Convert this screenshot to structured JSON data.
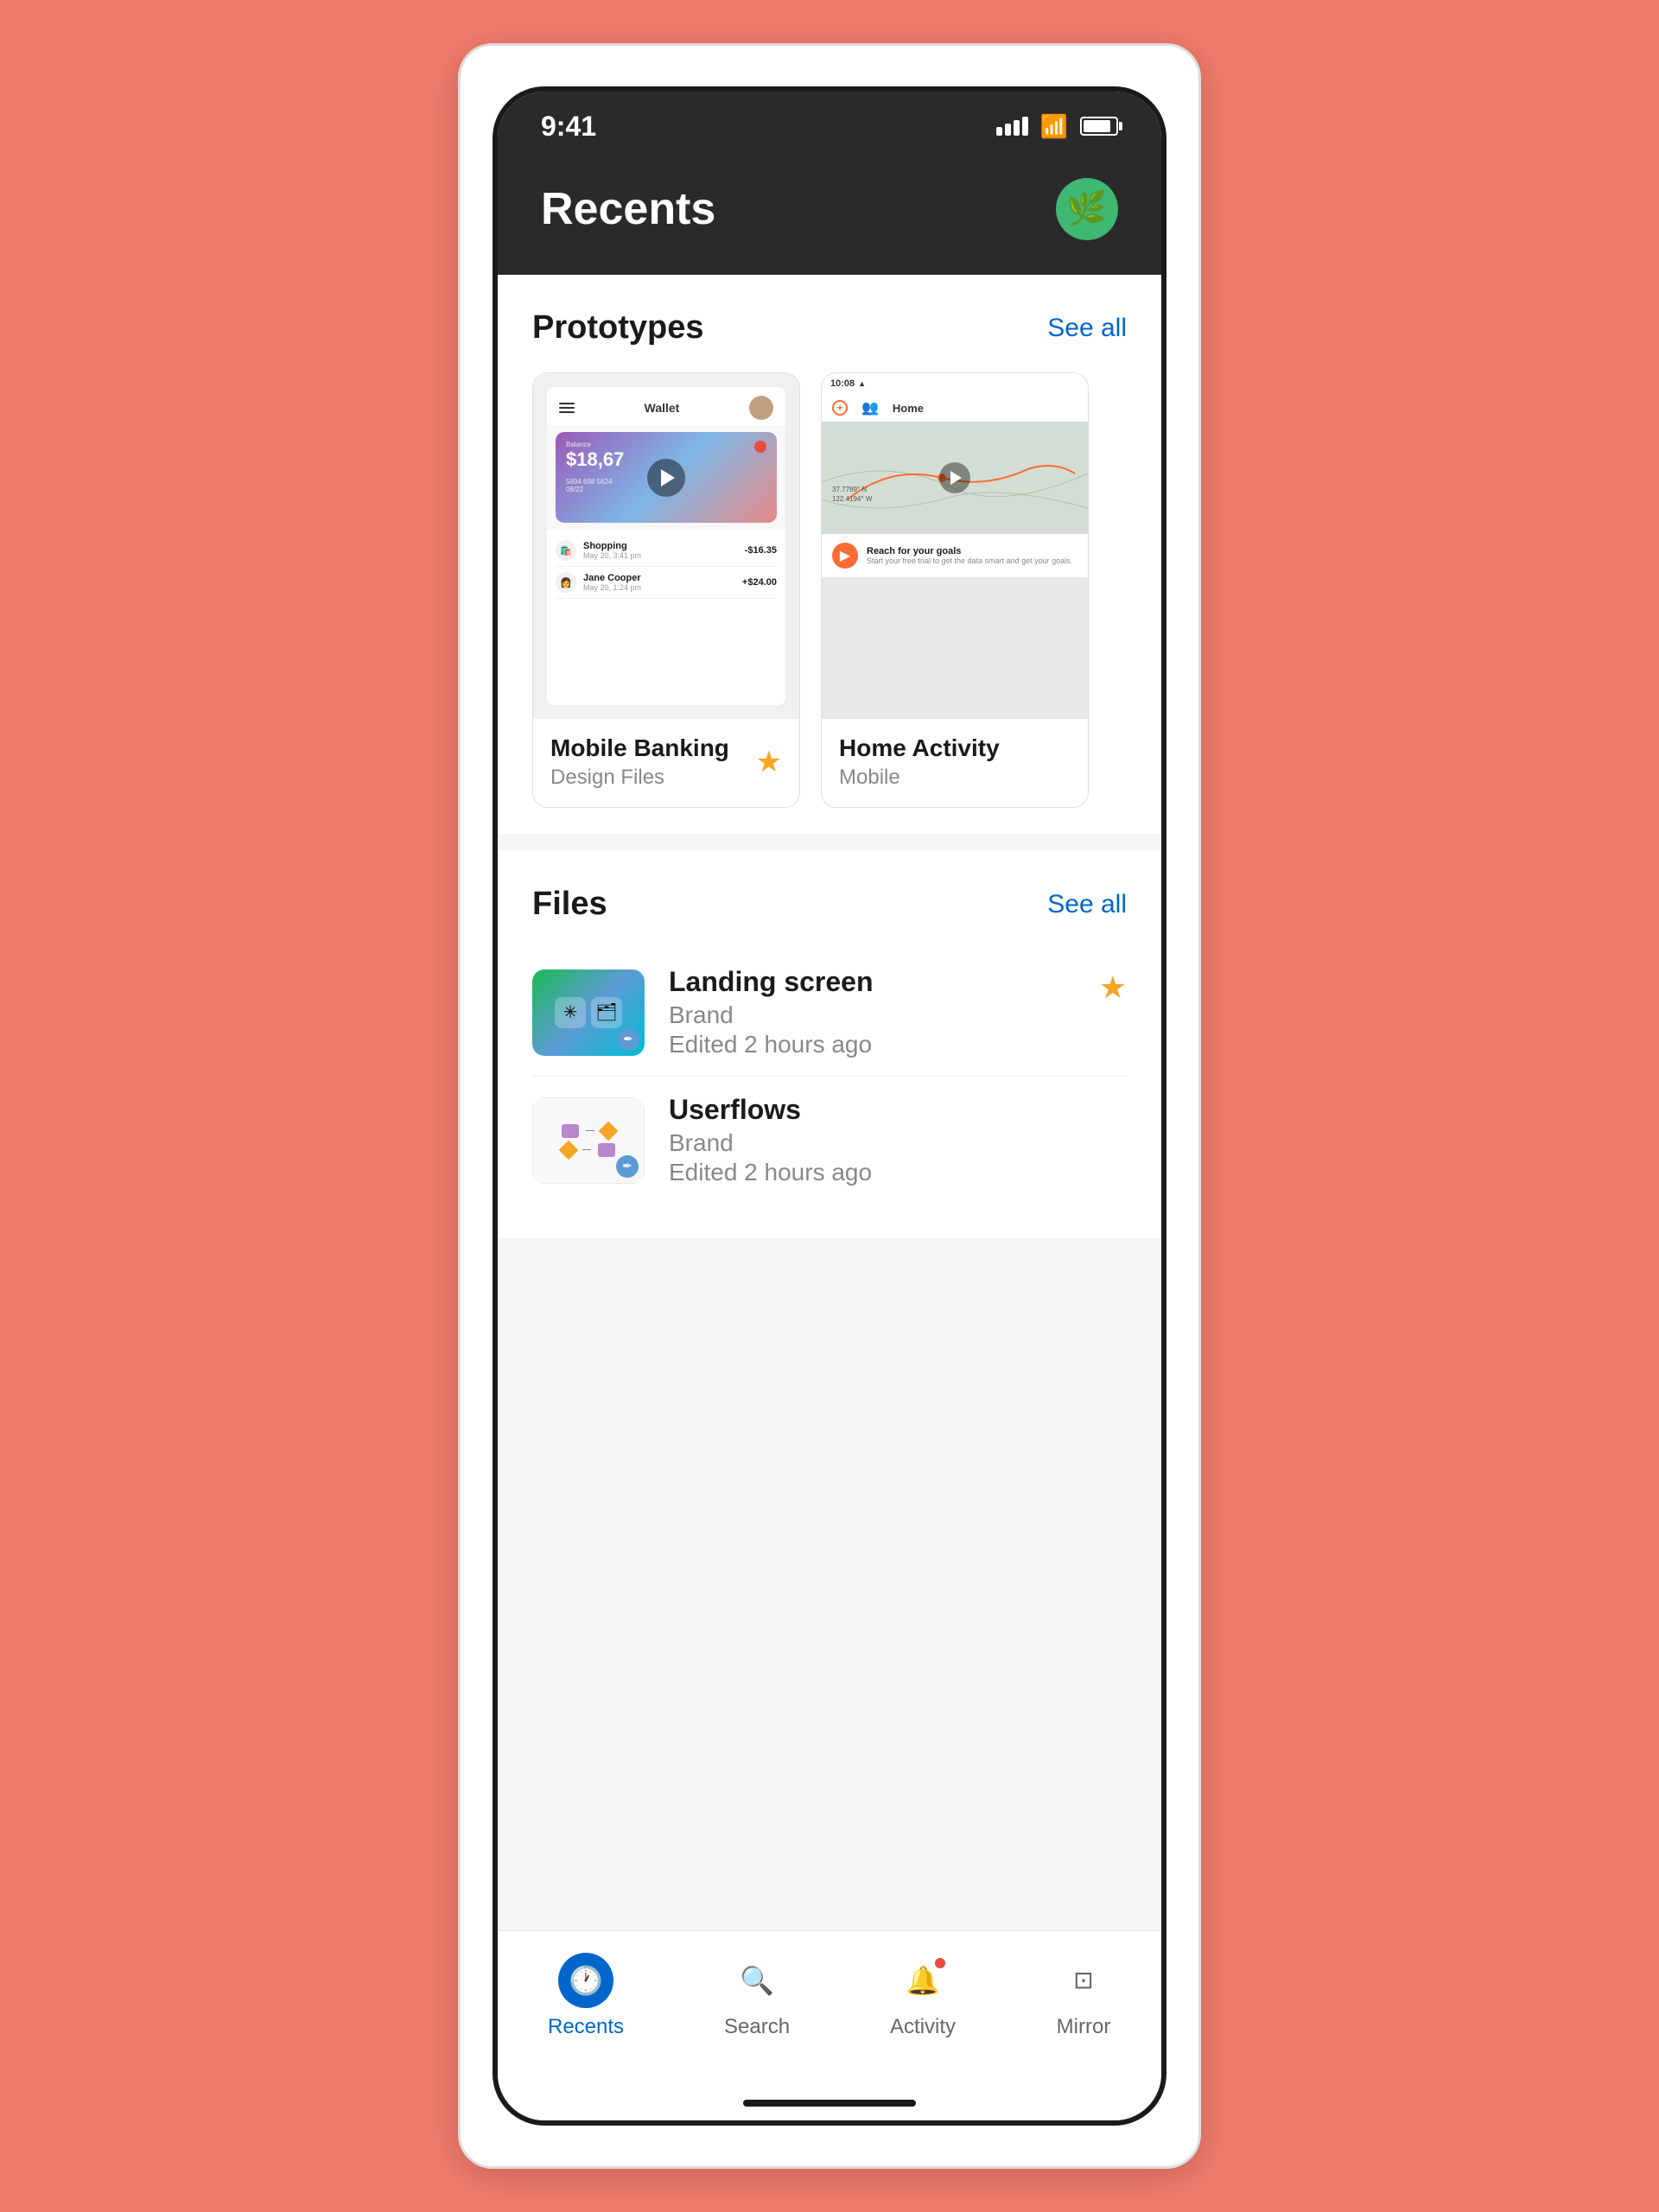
{
  "app": {
    "background_color": "#F07B6B"
  },
  "status_bar": {
    "time": "9:41",
    "signal_label": "signal",
    "wifi_label": "wifi",
    "battery_label": "battery"
  },
  "header": {
    "title": "Recents",
    "avatar_icon": "🌿"
  },
  "prototypes_section": {
    "title": "Prototypes",
    "see_all_label": "See all",
    "cards": [
      {
        "id": "mobile-banking",
        "preview": "mobile-banking",
        "title": "Mobile Banking",
        "subtitle": "Design Files",
        "starred": true,
        "wallet_title": "Wallet",
        "balance_label": "Balance",
        "balance_amount": "$18,67",
        "card_numbers": "5894  698  5624",
        "card_date": "08/22",
        "transactions": [
          {
            "name": "Shopping",
            "date": "May 20, 3:41 pm",
            "amount": "-$16.35",
            "type": "negative"
          },
          {
            "name": "Jane Cooper",
            "date": "May 20, 1:24 pm",
            "amount": "+$24.00",
            "type": "positive"
          }
        ]
      },
      {
        "id": "home-activity",
        "preview": "home-activity",
        "title": "Home Activity",
        "subtitle": "Mobile",
        "starred": false,
        "status_time": "10:08",
        "nav_label": "Home",
        "promo_title": "Reach for your goals",
        "promo_subtitle": "Start your free trial to get the data smart and get your goals.",
        "coords": "37.7789° N\n122.4194° W"
      }
    ]
  },
  "files_section": {
    "title": "Files",
    "see_all_label": "See all",
    "files": [
      {
        "id": "landing-screen",
        "name": "Landing screen",
        "brand": "Brand",
        "edited": "Edited 2 hours ago",
        "starred": true
      },
      {
        "id": "userflows",
        "name": "Userflows",
        "brand": "Brand",
        "edited": "Edited 2 hours ago",
        "starred": false
      }
    ]
  },
  "bottom_nav": {
    "items": [
      {
        "id": "recents",
        "label": "Recents",
        "icon": "🕐",
        "active": true
      },
      {
        "id": "search",
        "label": "Search",
        "icon": "🔍",
        "active": false
      },
      {
        "id": "activity",
        "label": "Activity",
        "icon": "🔔",
        "active": false,
        "notification": true
      },
      {
        "id": "mirror",
        "label": "Mirror",
        "icon": "⊡",
        "active": false
      }
    ]
  }
}
